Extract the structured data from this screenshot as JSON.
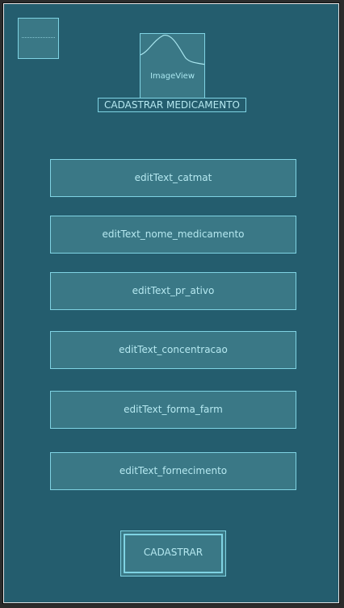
{
  "header": {
    "image_view_label": "ImageView",
    "title": "CADASTRAR MEDICAMENTO"
  },
  "form": {
    "fields": [
      {
        "label": "editText_catmat"
      },
      {
        "label": "editText_nome_medicamento"
      },
      {
        "label": "editText_pr_ativo"
      },
      {
        "label": "editText_concentracao"
      },
      {
        "label": "editText_forma_farm"
      },
      {
        "label": "editText_fornecimento"
      }
    ],
    "submit_label": "CADASTRAR"
  },
  "colors": {
    "background": "#245d6e",
    "widget_fill": "#3a7886",
    "outline": "#7fd3e3",
    "text": "#b5e8f0"
  }
}
